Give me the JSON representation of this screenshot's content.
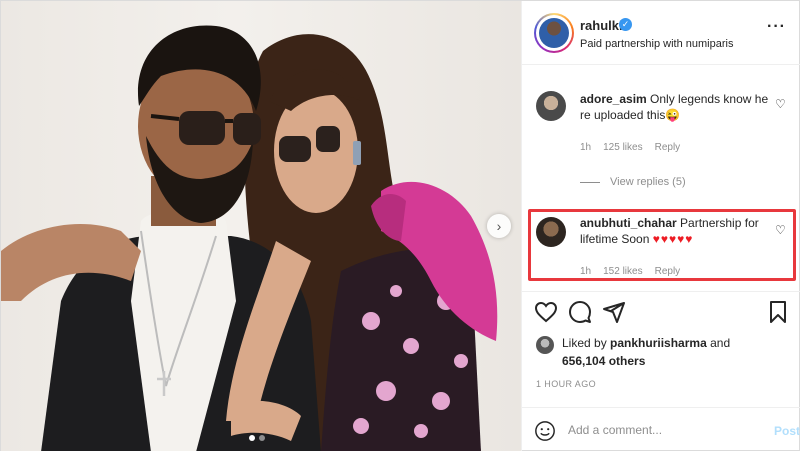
{
  "header": {
    "username": "rahulkl",
    "verified_icon": "verified-badge-icon",
    "subtitle": "Paid partnership with numiparis",
    "more_icon": "more-options-icon"
  },
  "photo": {
    "carousel_next_icon": "chevron-right-icon",
    "carousel_page": 1,
    "carousel_total": 2
  },
  "comments": [
    {
      "username": "adore_asim",
      "text": "Only legends know he re uploaded this😜",
      "time": "1h",
      "likes": "125 likes",
      "reply": "Reply",
      "view_replies": "View replies (5)"
    },
    {
      "username": "anubhuti_chahar",
      "text": "Partnership for lifetime Soon",
      "hearts": "♥♥♥♥♥",
      "time": "1h",
      "likes": "152 likes",
      "reply": "Reply"
    }
  ],
  "likes": {
    "prefix": "Liked by",
    "user": "pankhuriisharma",
    "connector": "and",
    "others": "656,104 others"
  },
  "timestamp": "1 HOUR AGO",
  "comment_box": {
    "placeholder": "Add a comment...",
    "post_label": "Post"
  },
  "colors": {
    "highlight": "#e8383d",
    "verified": "#3897f0",
    "post_button_disabled": "#b2dffc"
  }
}
